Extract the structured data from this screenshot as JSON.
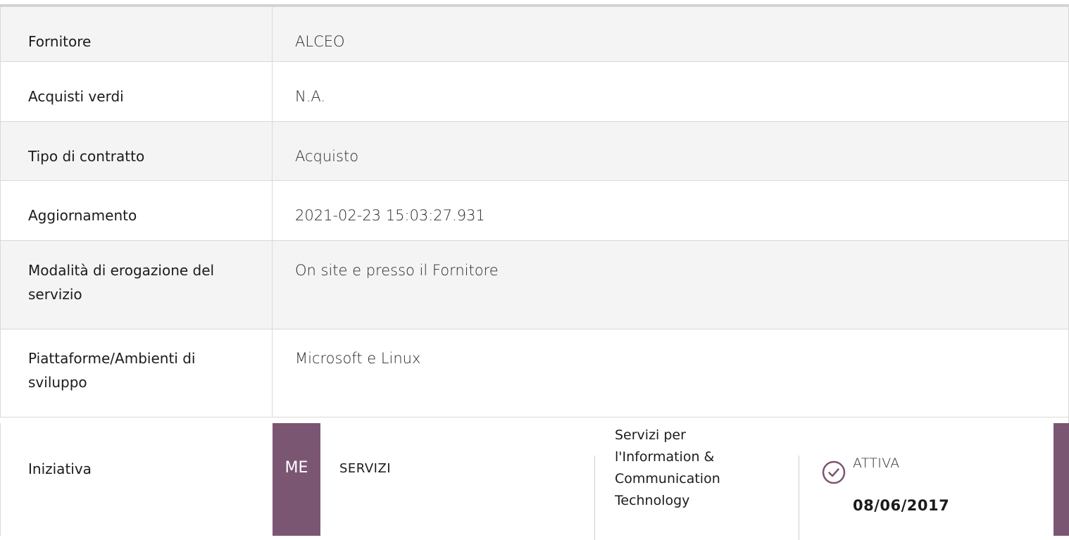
{
  "rows": [
    {
      "key": "Fornitore",
      "value": "ALCEO"
    },
    {
      "key": "Acquisti verdi",
      "value": "N.A."
    },
    {
      "key": "Tipo di contratto",
      "value": "Acquisto"
    },
    {
      "key": "Aggiornamento",
      "value": "2021-02-23 15:03:27.931"
    },
    {
      "key": "Modalità di erogazione del servizio",
      "value": "On site e presso il Fornitore"
    },
    {
      "key": "Piattaforme/Ambienti di sviluppo",
      "value": "Microsoft e Linux"
    }
  ],
  "initiative": {
    "label": "Iniziativa",
    "badge": "ME",
    "type": "SERVIZI",
    "category": "Servizi per l'Information & Communication Technology",
    "status": "ATTIVA",
    "date": "08/06/2017",
    "status_icon": "check-circle-icon",
    "accent_color": "#7b5673"
  }
}
